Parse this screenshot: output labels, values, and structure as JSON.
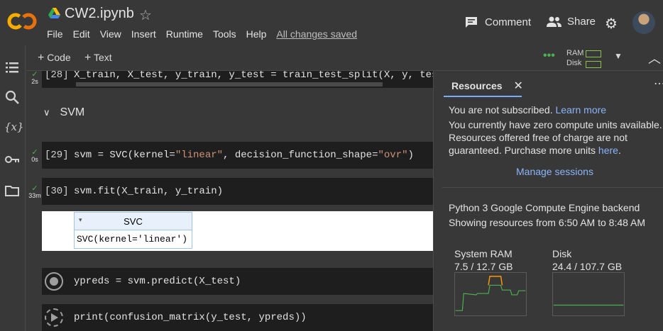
{
  "header": {
    "title": "CW2.ipynb",
    "menu": [
      "File",
      "Edit",
      "View",
      "Insert",
      "Runtime",
      "Tools",
      "Help"
    ],
    "saved_status": "All changes saved",
    "comment_label": "Comment",
    "share_label": "Share"
  },
  "toolbar": {
    "add_code_label": "Code",
    "add_text_label": "Text",
    "ram_label": "RAM",
    "disk_label": "Disk"
  },
  "cells": [
    {
      "prompt": "[28]",
      "code": "X_train, X_test, y_train, y_test = train_test_split(X, y, test_",
      "status": "2s"
    },
    {
      "prompt": "[29]",
      "code_pre": "svm = SVC(kernel=",
      "code_str1": "\"linear\"",
      "code_mid": ", decision_function_shape=",
      "code_str2": "\"ovr\"",
      "code_post": ")",
      "status": "0s"
    },
    {
      "prompt": "[30]",
      "code": "svm.fit(X_train, y_train)",
      "status": "33m"
    },
    {
      "code": "ypreds = svm.predict(X_test)"
    },
    {
      "code": "print(confusion_matrix(y_test, ypreds))"
    }
  ],
  "section_title": "SVM",
  "output": {
    "header": "SVC",
    "toggle": "▾",
    "body": "SVC(kernel='linear')"
  },
  "panel": {
    "tab_label": "Resources",
    "not_subscribed": "You are not subscribed.",
    "learn_more": "Learn more",
    "zero_units_1": "You currently have zero compute units available.",
    "zero_units_2": "Resources offered free of charge are not",
    "zero_units_3": "guaranteed. Purchase more units",
    "here": "here",
    "manage_sessions": "Manage sessions",
    "backend": "Python 3 Google Compute Engine backend",
    "range": "Showing resources from 6:50 AM to 8:48 AM",
    "ram_title": "System RAM",
    "ram_value": "7.5 / 12.7 GB",
    "disk_title": "Disk",
    "disk_value": "24.4 / 107.7 GB"
  },
  "colors": {
    "accent_link": "#8ab4f8",
    "ok_green": "#4caf50",
    "ram_orange": "#ff9800"
  }
}
